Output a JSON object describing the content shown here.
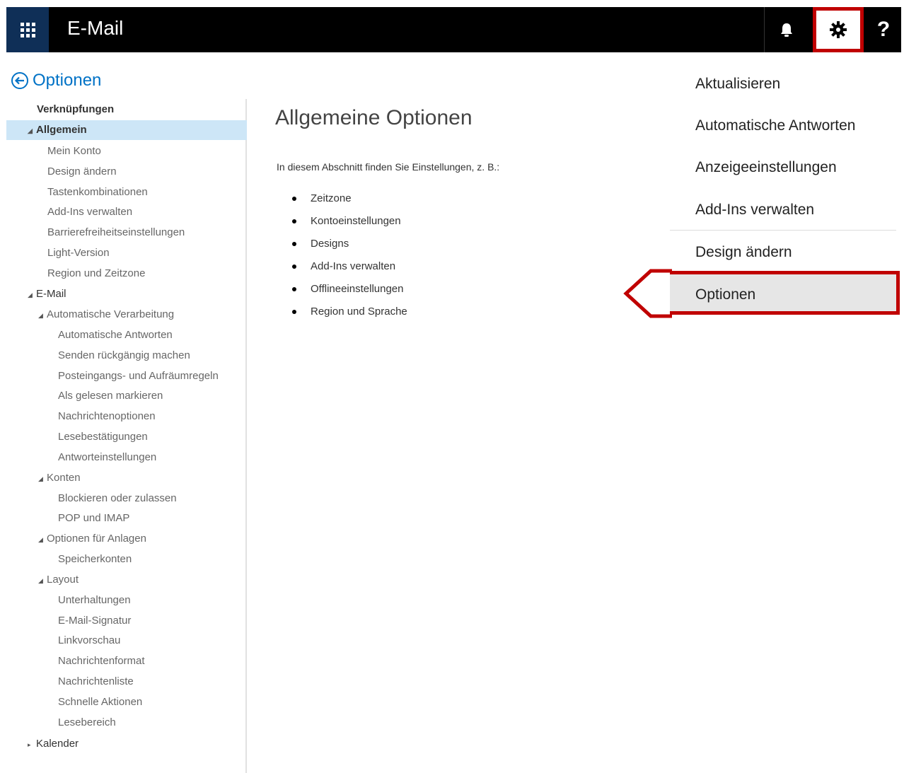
{
  "header": {
    "app_title": "E-Mail",
    "icons": [
      "waffle-icon",
      "bell-icon",
      "gear-icon",
      "help-icon"
    ],
    "help_label": "?"
  },
  "back_link": {
    "label": "Optionen"
  },
  "nav": {
    "items": [
      {
        "label": "Verknüpfungen",
        "level": 0,
        "kind": "head"
      },
      {
        "label": "Allgemein",
        "level": 0,
        "kind": "selected",
        "expanded": true
      },
      {
        "label": "Mein Konto",
        "level": 1
      },
      {
        "label": "Design ändern",
        "level": 1
      },
      {
        "label": "Tastenkombinationen",
        "level": 1
      },
      {
        "label": "Add-Ins verwalten",
        "level": 1
      },
      {
        "label": "Barrierefreiheitseinstellungen",
        "level": 1
      },
      {
        "label": "Light-Version",
        "level": 1
      },
      {
        "label": "Region und Zeitzone",
        "level": 1
      },
      {
        "label": "E-Mail",
        "level": 0,
        "kind": "head",
        "expanded": true
      },
      {
        "label": "Automatische Verarbeitung",
        "level": 1,
        "expanded": true
      },
      {
        "label": "Automatische Antworten",
        "level": 2
      },
      {
        "label": "Senden rückgängig machen",
        "level": 2
      },
      {
        "label": "Posteingangs- und Aufräumregeln",
        "level": 2
      },
      {
        "label": "Als gelesen markieren",
        "level": 2
      },
      {
        "label": "Nachrichtenoptionen",
        "level": 2
      },
      {
        "label": "Lesebestätigungen",
        "level": 2
      },
      {
        "label": "Antworteinstellungen",
        "level": 2
      },
      {
        "label": "Konten",
        "level": 1,
        "expanded": true
      },
      {
        "label": "Blockieren oder zulassen",
        "level": 2
      },
      {
        "label": "POP und IMAP",
        "level": 2
      },
      {
        "label": "Optionen für Anlagen",
        "level": 1,
        "expanded": true
      },
      {
        "label": "Speicherkonten",
        "level": 2
      },
      {
        "label": "Layout",
        "level": 1,
        "expanded": true
      },
      {
        "label": "Unterhaltungen",
        "level": 2
      },
      {
        "label": "E-Mail-Signatur",
        "level": 2
      },
      {
        "label": "Linkvorschau",
        "level": 2
      },
      {
        "label": "Nachrichtenformat",
        "level": 2
      },
      {
        "label": "Nachrichtenliste",
        "level": 2
      },
      {
        "label": "Schnelle Aktionen",
        "level": 2
      },
      {
        "label": "Lesebereich",
        "level": 2
      },
      {
        "label": "Kalender",
        "level": 0,
        "kind": "head",
        "expanded": false
      }
    ]
  },
  "main": {
    "title": "Allgemeine Optionen",
    "intro": "In diesem Abschnitt finden Sie Einstellungen, z. B.:",
    "bullets": [
      "Zeitzone",
      "Kontoeinstellungen",
      "Designs",
      "Add-Ins verwalten",
      "Offlineeinstellungen",
      "Region und Sprache"
    ]
  },
  "settings_menu": {
    "items": [
      "Aktualisieren",
      "Automatische Antworten",
      "Anzeigeeinstellungen",
      "Add-Ins verwalten",
      "Design ändern",
      "Optionen"
    ],
    "highlighted": "Optionen"
  },
  "colors": {
    "topbar": "#000000",
    "waffle_bg": "#0f2f57",
    "link": "#0072c6",
    "nav_selected": "#cde6f7",
    "highlight_red": "#c00000",
    "menu_hover": "#e6e6e6"
  }
}
